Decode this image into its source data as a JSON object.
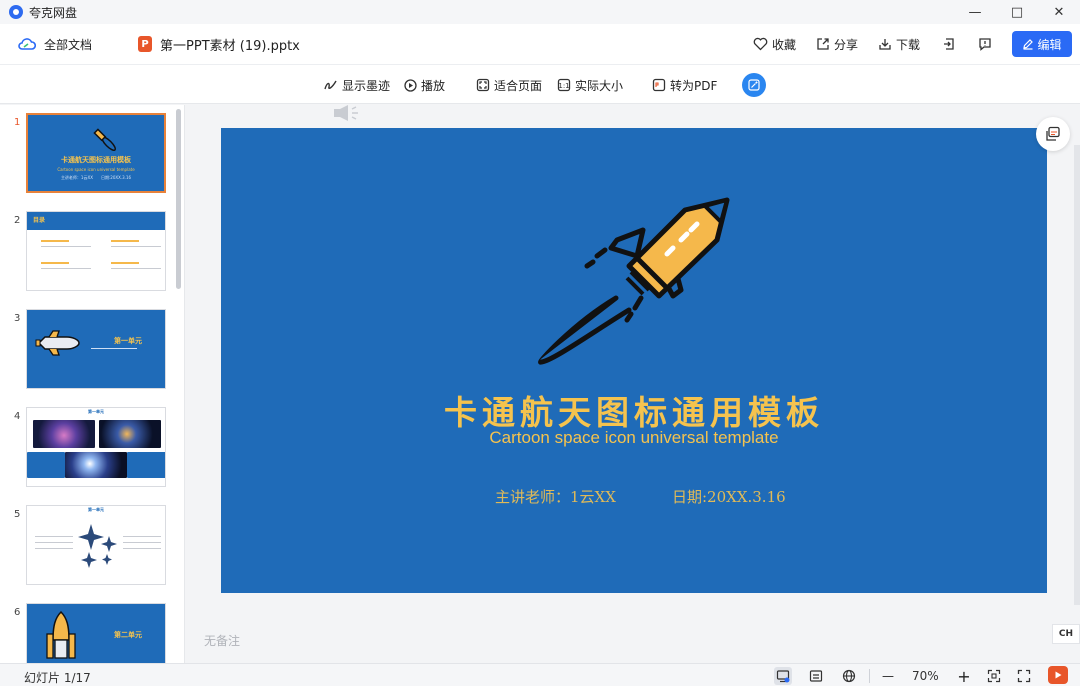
{
  "window": {
    "app_title": "夸克网盘",
    "minimize": "—",
    "maximize": "□",
    "close": "✕"
  },
  "toolbar": {
    "all_docs": "全部文档",
    "file_badge": "P",
    "file_name": "第一PPT素材 (19).pptx",
    "favorite": "收藏",
    "share": "分享",
    "download": "下载",
    "edit": "编辑"
  },
  "viewbar": {
    "show_ink": "显示墨迹",
    "play": "播放",
    "fit_page": "适合页面",
    "actual_size": "实际大小",
    "to_pdf": "转为PDF"
  },
  "thumbnails": [
    {
      "num": "1",
      "title": "卡通航天图标通用模板",
      "sub": "Cartoon space icon universal template",
      "info": "主讲老师：1云XX　　日期:20XX.3.16"
    },
    {
      "num": "2",
      "title": "目录"
    },
    {
      "num": "3",
      "title": "第一单元"
    },
    {
      "num": "4",
      "title": "第一单元"
    },
    {
      "num": "5",
      "title": "第一单元"
    },
    {
      "num": "6",
      "title": "第二单元"
    }
  ],
  "slide": {
    "title": "卡通航天图标通用模板",
    "subtitle": "Cartoon space icon universal template",
    "teacher": "主讲老师：1云XX",
    "date": "日期:20XX.3.16",
    "bg_color": "#1f6bb8",
    "accent_color": "#f5c34e"
  },
  "notes": {
    "placeholder": "无备注"
  },
  "statusbar": {
    "slide_counter": "幻灯片 1/17",
    "zoom": "70%",
    "zoom_out": "—",
    "zoom_in": "+"
  },
  "ime": {
    "label": "CH"
  }
}
